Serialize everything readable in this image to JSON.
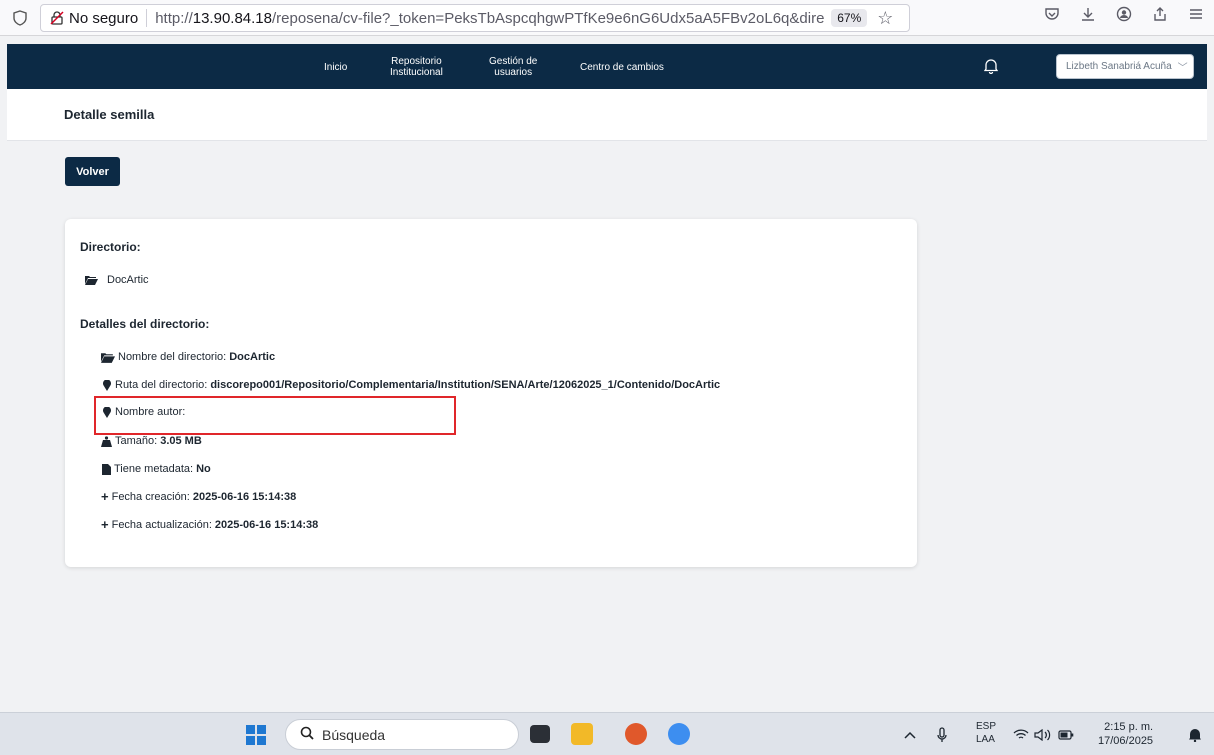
{
  "browser": {
    "security_label": "No seguro",
    "url_prefix": "http://",
    "url_host": "13.90.84.18",
    "url_rest": "/reposena/cv-file?_token=PeksTbAspcqhgwPTfKe9e6nG6Udx5aA5FBv2oL6q&directori",
    "zoom": "67%"
  },
  "nav": {
    "inicio": "Inicio",
    "repo_line1": "Repositorio",
    "repo_line2": "Institucional",
    "users_line1": "Gestión de",
    "users_line2": "usuarios",
    "changes": "Centro de cambios",
    "user_name": "Lizbeth Sanabriá Acuña"
  },
  "page": {
    "title": "Detalle semilla",
    "back_label": "Volver"
  },
  "card": {
    "directory_heading": "Directorio:",
    "directory_name": "DocArtic",
    "details_heading": "Detalles del directorio:",
    "rows": {
      "name_label": "Nombre del directorio:",
      "name_value": "DocArtic",
      "path_label": "Ruta del directorio:",
      "path_value": "discorepo001/Repositorio/Complementaria/Institution/SENA/Arte/12062025_1/Contenido/DocArtic",
      "author_label": "Nombre autor:",
      "author_value": "",
      "size_label": "Tamaño:",
      "size_value": "3.05 MB",
      "metadata_label": "Tiene metadata:",
      "metadata_value": "No",
      "created_label": "Fecha creación:",
      "created_value": "2025-06-16 15:14:38",
      "updated_label": "Fecha actualización:",
      "updated_value": "2025-06-16 15:14:38"
    }
  },
  "taskbar": {
    "search_placeholder": "Búsqueda",
    "lang_line1": "ESP",
    "lang_line2": "LAA",
    "time": "2:15 p. m.",
    "date": "17/06/2025"
  },
  "colors": {
    "nav_bg": "#0c2a45",
    "highlight": "#e0262a"
  }
}
